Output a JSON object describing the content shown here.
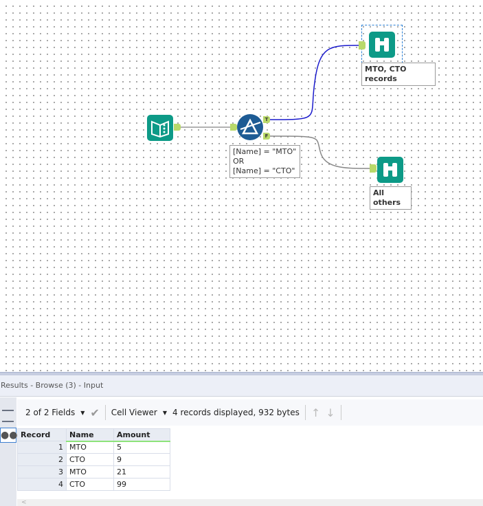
{
  "canvas": {
    "filter_expression": [
      "[Name] = \"MTO\"",
      "OR",
      "[Name] = \"CTO\""
    ],
    "true_anchor": "T",
    "false_anchor": "F",
    "browse_true_label": "MTO, CTO records",
    "browse_false_label": "All others",
    "colors": {
      "tool": "#0d9a87",
      "filter": "#1d5b94",
      "true_line": "#1a1acc",
      "line": "#888888",
      "anchor": "#b9d96a"
    }
  },
  "results": {
    "title": "Results - Browse (3) - Input",
    "fields_label": "2 of 2 Fields",
    "viewer_label": "Cell Viewer",
    "status": "4 records displayed, 932 bytes",
    "columns": [
      "Record",
      "Name",
      "Amount"
    ],
    "rows": [
      [
        "1",
        "MTO",
        "5"
      ],
      [
        "2",
        "CTO",
        "9"
      ],
      [
        "3",
        "MTO",
        "21"
      ],
      [
        "4",
        "CTO",
        "99"
      ]
    ],
    "scroll_left": "<"
  }
}
